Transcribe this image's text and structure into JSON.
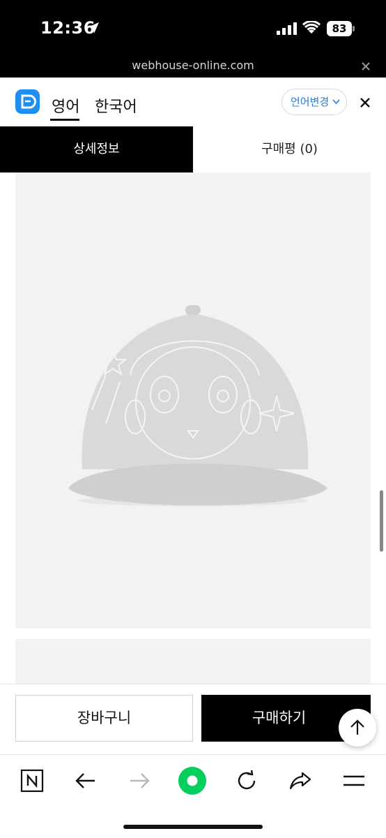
{
  "status_bar": {
    "time": "12:36",
    "battery": "83"
  },
  "browser": {
    "url": "webhouse-online.com"
  },
  "translate_bar": {
    "lang_from": "영어",
    "lang_to": "한국어",
    "change_label": "언어변경"
  },
  "tabs": [
    {
      "label": "상세정보",
      "active": true
    },
    {
      "label": "구매평 (0)",
      "active": false
    }
  ],
  "product": {
    "image_subject": "light gray embroidered cap"
  },
  "actions": {
    "cart_label": "장바구니",
    "buy_label": "구매하기"
  },
  "icons": [
    "location-arrow-icon",
    "signal-icon",
    "wifi-icon",
    "battery-icon",
    "close-icon",
    "translate-logo-icon",
    "chevron-down-icon",
    "arrow-up-icon",
    "naver-n-icon",
    "back-arrow-icon",
    "forward-arrow-icon",
    "home-dot-icon",
    "refresh-icon",
    "share-icon",
    "menu-icon"
  ],
  "colors": {
    "accent_blue": "#1f8ef1",
    "home_green": "#03cf5d",
    "active_tab": "#000000"
  }
}
